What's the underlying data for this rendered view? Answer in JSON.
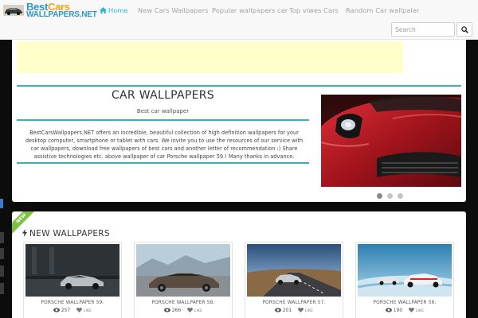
{
  "brand": {
    "line1a": "Best",
    "line1b": "Cars",
    "line2": "WALLPAPERS.NET"
  },
  "nav": {
    "home": "Home",
    "new_cars": "New Cars Wallpapers",
    "popular": "Popular wallpapers car",
    "top_views": "Top viwes Cars",
    "random": "Random Car wallpaler"
  },
  "search": {
    "placeholder": "Search"
  },
  "intro": {
    "title": "CAR WALLPAPERS",
    "subtitle": "Best car wallpaper",
    "description": "BestCarsWallpapers.NET offers an incredible, beautiful collection of high definition wallpapers for your desktop computer, smartphone or tablet with cars. We invite you to use the resources of our service with car wallpapers, download free wallpapers of best cars and another letter of recommendation :) Share assistive technologies etc. above wallpaper of car Porsche wallpaper 59.! Many thanks in advance."
  },
  "slider": {
    "dots": 3,
    "active": 1
  },
  "new_wallpapers": {
    "ribbon": "NEW",
    "title": "NEW WALLPAPERS",
    "like_label": "LIKE",
    "items": [
      {
        "title": "PORSCHE WALLPAPER 59.",
        "views": "257"
      },
      {
        "title": "PORSCHE WALLPAPER 58.",
        "views": "266"
      },
      {
        "title": "PORSCHE WALLPAPER 57.",
        "views": "201"
      },
      {
        "title": "PORSCHE WALLPAPER 56.",
        "views": "190"
      }
    ]
  },
  "colors": {
    "accent": "#3cb0b3",
    "nav_active": "#2fb8c8",
    "brand_blue": "#2f96c9",
    "brand_orange": "#f5a21b",
    "ad_bg": "#ffffcc",
    "new_ribbon": "#7cc142"
  }
}
